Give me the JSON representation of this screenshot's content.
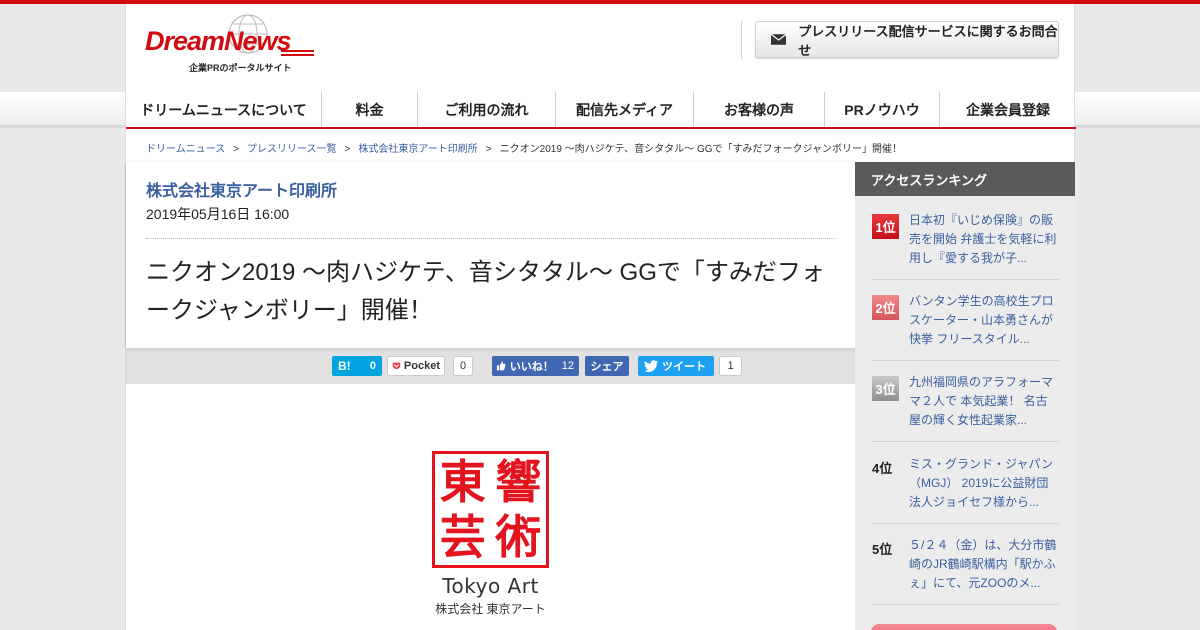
{
  "header": {
    "logo_text": "DreamNews",
    "logo_tagline": "企業PRのポータルサイト",
    "contact_button": "プレスリリース配信サービスに関するお問合せ"
  },
  "nav": {
    "items": [
      {
        "label": "ドリームニュースについて"
      },
      {
        "label": "料金"
      },
      {
        "label": "ご利用の流れ"
      },
      {
        "label": "配信先メディア"
      },
      {
        "label": "お客様の声"
      },
      {
        "label": "PRノウハウ"
      },
      {
        "label": "企業会員登録"
      }
    ]
  },
  "breadcrumb": {
    "sep": ">",
    "items": [
      "ドリームニュース",
      "プレスリリース一覧",
      "株式会社東京アート印刷所"
    ],
    "current": "ニクオン2019 ～肉ハジケテ、音シタタル～ GGで「すみだフォークジャンボリー」開催！"
  },
  "article": {
    "company": "株式会社東京アート印刷所",
    "date": "2019年05月16日 16:00",
    "title": "ニクオン2019 ～肉ハジケテ、音シタタル～ GGで「すみだフォークジャンボリー」開催！"
  },
  "share": {
    "hatena_label": "B!",
    "hatena_count": "0",
    "pocket_label": "Pocket",
    "pocket_count": "0",
    "fb_like_label": "いいね！",
    "fb_like_count": "12",
    "fb_share_label": "シェア",
    "tweet_label": "ツイート",
    "tweet_count": "1"
  },
  "logo_image": {
    "seal_chars": [
      "東",
      "響",
      "芸",
      "術"
    ],
    "brand": "Tokyo Art",
    "brand_sub": "株式会社 東京アート"
  },
  "sidebar": {
    "heading": "アクセスランキング",
    "ranks": [
      {
        "rank": "1位",
        "text": "日本初『いじめ保険』の販売を開始 弁護士を気軽に利用し『愛する我が子..."
      },
      {
        "rank": "2位",
        "text": "バンタン学生の高校生プロスケーター・山本勇さんが快挙 フリースタイル..."
      },
      {
        "rank": "3位",
        "text": "九州福岡県のアラフォーママ２人で 本気起業！ 名古屋の輝く女性起業家..."
      },
      {
        "rank": "4位",
        "text": "ミス・グランド・ジャパン（MGJ） 2019に公益財団法人ジョイセフ様から..."
      },
      {
        "rank": "5位",
        "text": "５/２４（金）は、大分市鶴崎のJR鶴崎駅構内「駅かふぇ」にて、元ZOOのメ..."
      }
    ]
  },
  "colors": {
    "brand_red": "#d20a11",
    "link_blue": "#3a5fa0",
    "hatena": "#00a4de",
    "facebook": "#4267b2",
    "twitter": "#1da1f2"
  }
}
